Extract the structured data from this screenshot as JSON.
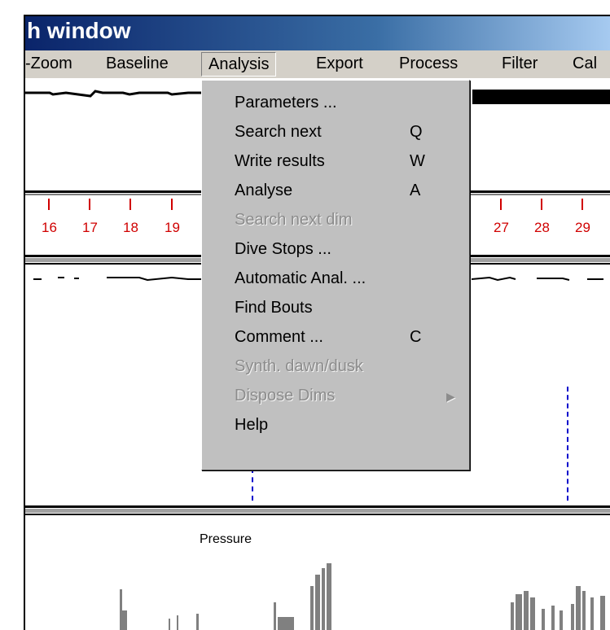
{
  "window": {
    "title": "h window"
  },
  "menubar": {
    "items": [
      {
        "label": "-Zoom"
      },
      {
        "label": "Baseline"
      },
      {
        "label": "Analysis"
      },
      {
        "label": "Export"
      },
      {
        "label": "Process"
      },
      {
        "label": "Filter"
      },
      {
        "label": "Cal"
      }
    ]
  },
  "analysis_menu": {
    "items": [
      {
        "label": "Parameters ...",
        "shortcut": "",
        "enabled": true
      },
      {
        "label": "Search next",
        "shortcut": "Q",
        "enabled": true
      },
      {
        "label": "Write results",
        "shortcut": "W",
        "enabled": true
      },
      {
        "label": "Analyse",
        "shortcut": "A",
        "enabled": true
      },
      {
        "label": "Search next dim",
        "shortcut": "",
        "enabled": false
      },
      {
        "label": "Dive Stops ...",
        "shortcut": "",
        "enabled": true
      },
      {
        "label": "Automatic Anal. ...",
        "shortcut": "",
        "enabled": true
      },
      {
        "label": "Find Bouts",
        "shortcut": "",
        "enabled": true
      },
      {
        "label": "Comment ...",
        "shortcut": "C",
        "enabled": true
      },
      {
        "label": "Synth. dawn/dusk",
        "shortcut": "",
        "enabled": false
      },
      {
        "label": "Dispose Dims",
        "shortcut": "",
        "enabled": false,
        "submenu": true
      },
      {
        "label": "Help",
        "shortcut": "",
        "enabled": true
      }
    ]
  },
  "time_axis": {
    "ticks": [
      "16",
      "17",
      "18",
      "19",
      "27",
      "28",
      "29"
    ],
    "color": "#d00000"
  },
  "graph": {
    "pressure_label": "Pressure"
  },
  "colors": {
    "titlebar": "#0a246a",
    "menu_bg": "#c0c0c0",
    "disabled_text": "#8c8c8c",
    "marker": "#0000cc"
  }
}
